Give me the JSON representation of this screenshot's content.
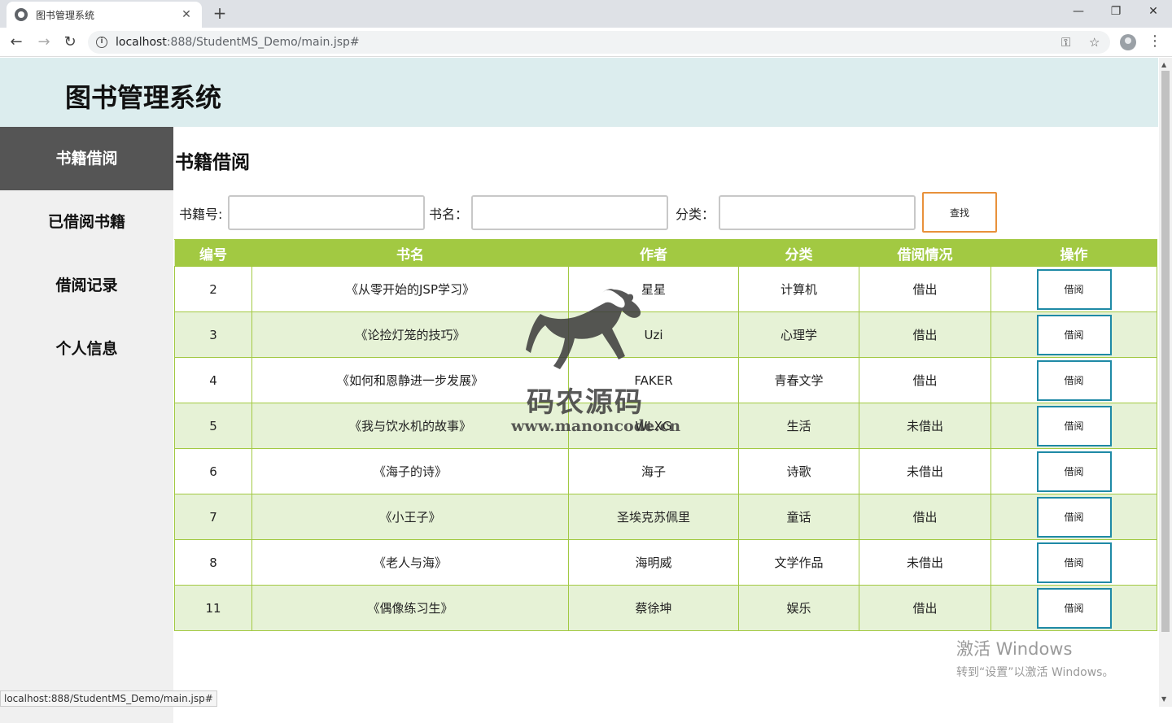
{
  "browser": {
    "tab_title": "图书管理系统",
    "tab_close": "✕",
    "new_tab": "+",
    "url_host": "localhost",
    "url_path": ":888/StudentMS_Demo/main.jsp#",
    "status_url": "localhost:888/StudentMS_Demo/main.jsp#"
  },
  "header": {
    "title": "图书管理系统"
  },
  "sidebar": {
    "items": [
      {
        "label": "书籍借阅",
        "active": true
      },
      {
        "label": "已借阅书籍"
      },
      {
        "label": "借阅记录"
      },
      {
        "label": "个人信息"
      }
    ]
  },
  "main": {
    "section_title": "书籍借阅",
    "search": {
      "id_label": "书籍号:",
      "name_label": "书名：",
      "category_label": "分类：",
      "button": "查找"
    },
    "table": {
      "headers": [
        "编号",
        "书名",
        "作者",
        "分类",
        "借阅情况",
        "操作"
      ],
      "rows": [
        {
          "id": "2",
          "title": "《从零开始的JSP学习》",
          "author": "星星",
          "category": "计算机",
          "status": "借出",
          "action": "借阅"
        },
        {
          "id": "3",
          "title": "《论捡灯笼的技巧》",
          "author": "Uzi",
          "category": "心理学",
          "status": "借出",
          "action": "借阅"
        },
        {
          "id": "4",
          "title": "《如何和恩静进一步发展》",
          "author": "FAKER",
          "category": "青春文学",
          "status": "借出",
          "action": "借阅"
        },
        {
          "id": "5",
          "title": "《我与饮水机的故事》",
          "author": "WLXG",
          "category": "生活",
          "status": "未借出",
          "action": "借阅"
        },
        {
          "id": "6",
          "title": "《海子的诗》",
          "author": "海子",
          "category": "诗歌",
          "status": "未借出",
          "action": "借阅"
        },
        {
          "id": "7",
          "title": "《小王子》",
          "author": "圣埃克苏佩里",
          "category": "童话",
          "status": "借出",
          "action": "借阅"
        },
        {
          "id": "8",
          "title": "《老人与海》",
          "author": "海明威",
          "category": "文学作品",
          "status": "未借出",
          "action": "借阅"
        },
        {
          "id": "11",
          "title": "《偶像练习生》",
          "author": "蔡徐坤",
          "category": "娱乐",
          "status": "借出",
          "action": "借阅"
        }
      ]
    }
  },
  "watermark": {
    "text": "码农源码",
    "url": "www.manoncode.cn"
  },
  "activate_windows": {
    "line1": "激活 Windows",
    "line2": "转到“设置”以激活 Windows。"
  },
  "colors": {
    "accent_green": "#a2c942",
    "row_alt": "#e6f2d6",
    "status_out": "#e02020",
    "borrow_border": "#1f8aa6",
    "search_border": "#e8913b"
  }
}
